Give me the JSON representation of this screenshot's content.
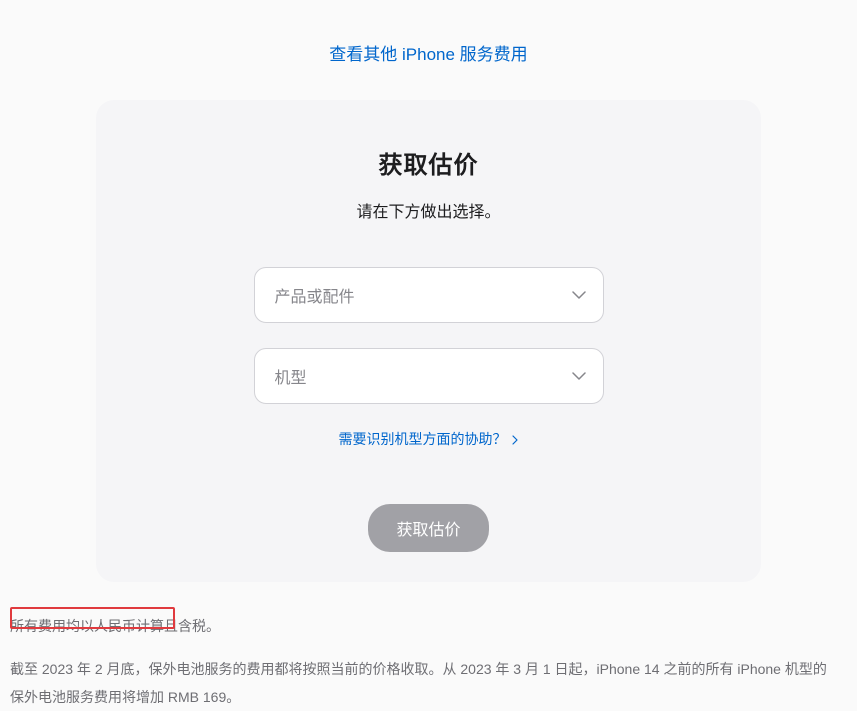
{
  "topLink": {
    "label": "查看其他 iPhone 服务费用"
  },
  "card": {
    "title": "获取估价",
    "subtitle": "请在下方做出选择。",
    "select1": {
      "placeholder": "产品或配件"
    },
    "select2": {
      "placeholder": "机型"
    },
    "helpLink": {
      "label": "需要识别机型方面的协助？"
    },
    "submitButton": {
      "label": "获取估价"
    }
  },
  "footer": {
    "note1": "所有费用均以人民币计算且含税。",
    "note2": "截至 2023 年 2 月底，保外电池服务的费用都将按照当前的价格收取。从 2023 年 3 月 1 日起，iPhone 14 之前的所有 iPhone 机型的保外电池服务费用将增加 RMB 169。"
  }
}
